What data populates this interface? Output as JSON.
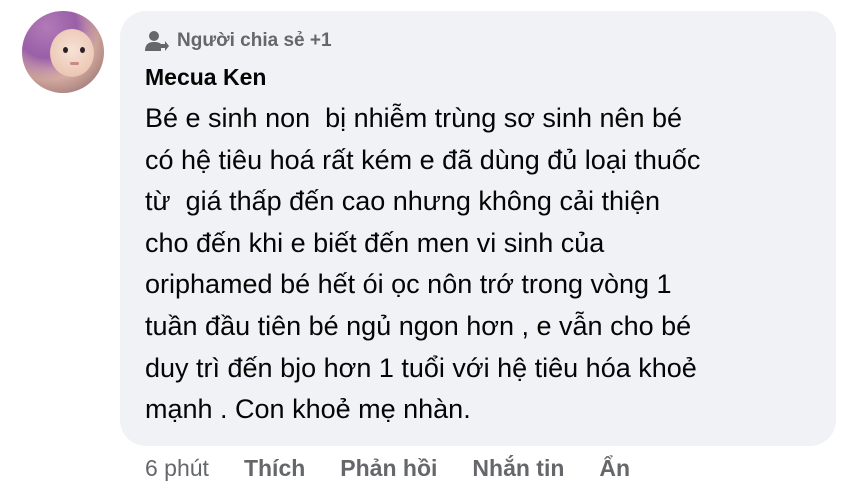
{
  "comment": {
    "shared_by": "Người chia sẻ +1",
    "author": "Mecua Ken",
    "text": "Bé e sinh non  bị nhiễm trùng sơ sinh nên bé\ncó hệ tiêu hoá rất kém e đã dùng đủ loại thuốc\ntừ  giá thấp đến cao nhưng không cải thiện\ncho đến khi e biết đến men vi sinh của\noriphamed bé hết ói ọc nôn trớ trong vòng 1\ntuần đầu tiên bé ngủ ngon hơn , e vẫn cho bé\nduy trì đến bjo hơn 1 tuổi với hệ tiêu hóa khoẻ\nmạnh . Con khoẻ mẹ nhàn."
  },
  "actions": {
    "time": "6 phút",
    "like": "Thích",
    "reply": "Phản hồi",
    "message": "Nhắn tin",
    "hide": "Ẩn"
  },
  "icons": {
    "shared": "person-share-icon"
  },
  "colors": {
    "bubble": "#f0f2f5",
    "secondary_text": "#65676b",
    "primary_text": "#050505"
  }
}
